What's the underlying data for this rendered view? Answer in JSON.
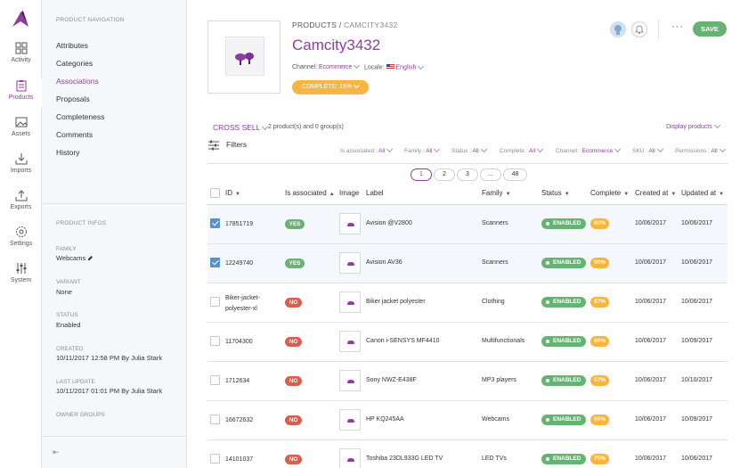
{
  "rail": {
    "items": [
      {
        "label": "Activity",
        "icon": "dashboard-icon"
      },
      {
        "label": "Products",
        "icon": "products-icon"
      },
      {
        "label": "Assets",
        "icon": "assets-icon"
      },
      {
        "label": "Imports",
        "icon": "imports-icon"
      },
      {
        "label": "Exports",
        "icon": "exports-icon"
      },
      {
        "label": "Settings",
        "icon": "settings-icon"
      },
      {
        "label": "System",
        "icon": "system-icon"
      }
    ],
    "active_color": "#8f3e9f"
  },
  "subnav": {
    "heading": "PRODUCT NAVIGATION",
    "links": [
      "Attributes",
      "Categories",
      "Associations",
      "Proposals",
      "Completeness",
      "Comments",
      "History"
    ],
    "active": "Associations",
    "info_heading": "PRODUCT INFOS",
    "info": [
      {
        "label": "FAMILY",
        "value": "Webcams"
      },
      {
        "label": "VARIANT",
        "value": "None"
      },
      {
        "label": "STATUS",
        "value": "Enabled"
      },
      {
        "label": "CREATED",
        "value": "10/11/2017 12:58 PM By Julia Stark"
      },
      {
        "label": "LAST UPDATE",
        "value": "10/11/2017 01:01 PM By Julia Stark"
      },
      {
        "label": "OWNER GROUPS",
        "value": ""
      }
    ]
  },
  "header": {
    "breadcrumb_root": "PRODUCTS",
    "breadcrumb_sep": " / ",
    "breadcrumb_sku": "CAMCITY3432",
    "title": "Camcity3432",
    "channel_label": "Channel:",
    "channel_value": "Ecommerce",
    "locale_label": "Locale:",
    "locale_value": "English",
    "completeness": "COMPLETE: 16%",
    "save": "SAVE",
    "more": "···"
  },
  "associations": {
    "type": "CROSS SELL",
    "count": "2 product(s) and 0 group(s)",
    "display": "Display products"
  },
  "filters": {
    "label": "Filters",
    "items": [
      {
        "name": "Is associated",
        "value": "All"
      },
      {
        "name": "Family",
        "value": "All"
      },
      {
        "name": "Status",
        "value": "All"
      },
      {
        "name": "Complete",
        "value": "All"
      },
      {
        "name": "Channel",
        "value": "Ecommerce"
      },
      {
        "name": "SKU",
        "value": "All"
      },
      {
        "name": "Permissions",
        "value": "All"
      }
    ]
  },
  "pagination": [
    "1",
    "2",
    "3",
    "...",
    "48"
  ],
  "table": {
    "columns": [
      "ID",
      "Is associated",
      "Image",
      "Label",
      "Family",
      "Status",
      "Complete",
      "Created at",
      "Updated at"
    ],
    "rows": [
      {
        "checked": true,
        "id": "17851719",
        "assoc": "YES",
        "label": "Avision @V2800",
        "family": "Scanners",
        "status": "ENABLED",
        "complete": "60%",
        "created": "10/06/2017",
        "updated": "10/06/2017"
      },
      {
        "checked": true,
        "id": "12249740",
        "assoc": "YES",
        "label": "Avision AV36",
        "family": "Scanners",
        "status": "ENABLED",
        "complete": "60%",
        "created": "10/06/2017",
        "updated": "10/06/2017"
      },
      {
        "checked": false,
        "id": "Biker-jacket-polyester-xl",
        "assoc": "NO",
        "label": "Biker jacket polyester",
        "family": "Clothing",
        "status": "ENABLED",
        "complete": "87%",
        "created": "10/06/2017",
        "updated": "10/06/2017"
      },
      {
        "checked": false,
        "id": "11704300",
        "assoc": "NO",
        "label": "Canon i-SENSYS MF4410",
        "family": "Multifunctionals",
        "status": "ENABLED",
        "complete": "66%",
        "created": "10/06/2017",
        "updated": "10/09/2017"
      },
      {
        "checked": false,
        "id": "1712634",
        "assoc": "NO",
        "label": "Sony NWZ-E438F",
        "family": "MP3 players",
        "status": "ENABLED",
        "complete": "57%",
        "created": "10/06/2017",
        "updated": "10/10/2017"
      },
      {
        "checked": false,
        "id": "16672632",
        "assoc": "NO",
        "label": "HP KQ245AA",
        "family": "Webcams",
        "status": "ENABLED",
        "complete": "66%",
        "created": "10/06/2017",
        "updated": "10/09/2017"
      },
      {
        "checked": false,
        "id": "14101037",
        "assoc": "NO",
        "label": "Toshiba 23DL933G LED TV",
        "family": "LED TVs",
        "status": "ENABLED",
        "complete": "75%",
        "created": "10/06/2017",
        "updated": "10/06/2017"
      }
    ]
  },
  "colors": {
    "accent": "#8f3e9f",
    "success": "#67b373",
    "danger": "#d4604f",
    "warning": "#f9b53f",
    "checkbox": "#5992c7"
  }
}
